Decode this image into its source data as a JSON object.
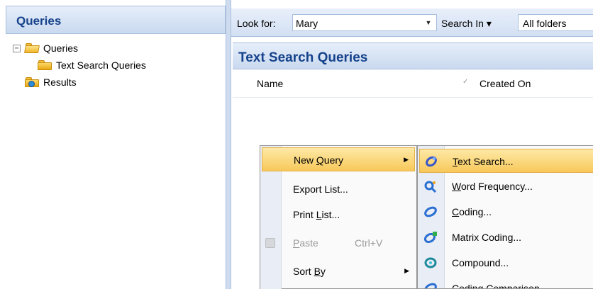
{
  "left_pane": {
    "title": "Queries",
    "tree": [
      {
        "label": "Queries",
        "expander": "−",
        "icon": "folder-open-icon"
      },
      {
        "label": "Text Search Queries",
        "icon": "folder-icon"
      },
      {
        "label": "Results",
        "icon": "results-folder-icon"
      }
    ]
  },
  "toolbar": {
    "look_for_label": "Look for:",
    "look_for_value": "Mary",
    "search_in_label": "Search In ▾",
    "folders_value": "All folders"
  },
  "content": {
    "title": "Text Search Queries",
    "columns": {
      "name": "Name",
      "created_on": "Created On"
    }
  },
  "context_menu": {
    "items": [
      {
        "label_pre": "New ",
        "label_ul": "Q",
        "label_post": "uery",
        "submenu": "▶",
        "highlighted": true
      },
      {
        "label_pre": "Export List",
        "label_ul": "",
        "label_post": "...",
        "highlighted": false
      },
      {
        "label_pre": "Print ",
        "label_ul": "L",
        "label_post": "ist...",
        "highlighted": false
      },
      {
        "label_pre": "",
        "label_ul": "P",
        "label_post": "aste",
        "shortcut": "Ctrl+V",
        "disabled": true
      },
      {
        "label_pre": "Sort ",
        "label_ul": "B",
        "label_post": "y",
        "submenu": "▶"
      }
    ]
  },
  "submenu": {
    "items": [
      {
        "label_ul": "T",
        "label_post": "ext Search...",
        "icon": "text-search-icon",
        "color": "#3a56c9",
        "highlighted": true
      },
      {
        "label_ul": "W",
        "label_post": "ord Frequency...",
        "icon": "word-frequency-icon",
        "color": "#2a6fd1"
      },
      {
        "label_ul": "C",
        "label_post": "oding...",
        "icon": "coding-query-icon",
        "color": "#2a6fd1"
      },
      {
        "label_ul": "",
        "label_post": "Matrix Coding...",
        "icon": "matrix-coding-icon",
        "color": "#2a6fd1"
      },
      {
        "label_ul": "",
        "label_post": "Compound...",
        "icon": "compound-query-icon",
        "color": "#1f8a9c"
      },
      {
        "label_ul": "",
        "label_post": "Coding Comparison...",
        "icon": "coding-comparison-icon",
        "color": "#2a6fd1"
      }
    ]
  },
  "colors": {
    "header_text": "#15428b",
    "highlight": "#f8c85a",
    "pane_header": "#c9d9ef"
  }
}
